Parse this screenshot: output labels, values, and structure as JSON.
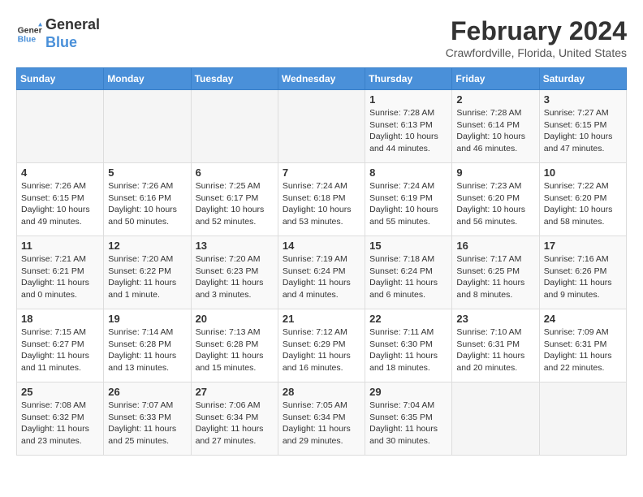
{
  "header": {
    "logo_line1": "General",
    "logo_line2": "Blue",
    "title": "February 2024",
    "subtitle": "Crawfordville, Florida, United States"
  },
  "weekdays": [
    "Sunday",
    "Monday",
    "Tuesday",
    "Wednesday",
    "Thursday",
    "Friday",
    "Saturday"
  ],
  "weeks": [
    [
      {
        "day": "",
        "info": ""
      },
      {
        "day": "",
        "info": ""
      },
      {
        "day": "",
        "info": ""
      },
      {
        "day": "",
        "info": ""
      },
      {
        "day": "1",
        "info": "Sunrise: 7:28 AM\nSunset: 6:13 PM\nDaylight: 10 hours\nand 44 minutes."
      },
      {
        "day": "2",
        "info": "Sunrise: 7:28 AM\nSunset: 6:14 PM\nDaylight: 10 hours\nand 46 minutes."
      },
      {
        "day": "3",
        "info": "Sunrise: 7:27 AM\nSunset: 6:15 PM\nDaylight: 10 hours\nand 47 minutes."
      }
    ],
    [
      {
        "day": "4",
        "info": "Sunrise: 7:26 AM\nSunset: 6:15 PM\nDaylight: 10 hours\nand 49 minutes."
      },
      {
        "day": "5",
        "info": "Sunrise: 7:26 AM\nSunset: 6:16 PM\nDaylight: 10 hours\nand 50 minutes."
      },
      {
        "day": "6",
        "info": "Sunrise: 7:25 AM\nSunset: 6:17 PM\nDaylight: 10 hours\nand 52 minutes."
      },
      {
        "day": "7",
        "info": "Sunrise: 7:24 AM\nSunset: 6:18 PM\nDaylight: 10 hours\nand 53 minutes."
      },
      {
        "day": "8",
        "info": "Sunrise: 7:24 AM\nSunset: 6:19 PM\nDaylight: 10 hours\nand 55 minutes."
      },
      {
        "day": "9",
        "info": "Sunrise: 7:23 AM\nSunset: 6:20 PM\nDaylight: 10 hours\nand 56 minutes."
      },
      {
        "day": "10",
        "info": "Sunrise: 7:22 AM\nSunset: 6:20 PM\nDaylight: 10 hours\nand 58 minutes."
      }
    ],
    [
      {
        "day": "11",
        "info": "Sunrise: 7:21 AM\nSunset: 6:21 PM\nDaylight: 11 hours\nand 0 minutes."
      },
      {
        "day": "12",
        "info": "Sunrise: 7:20 AM\nSunset: 6:22 PM\nDaylight: 11 hours\nand 1 minute."
      },
      {
        "day": "13",
        "info": "Sunrise: 7:20 AM\nSunset: 6:23 PM\nDaylight: 11 hours\nand 3 minutes."
      },
      {
        "day": "14",
        "info": "Sunrise: 7:19 AM\nSunset: 6:24 PM\nDaylight: 11 hours\nand 4 minutes."
      },
      {
        "day": "15",
        "info": "Sunrise: 7:18 AM\nSunset: 6:24 PM\nDaylight: 11 hours\nand 6 minutes."
      },
      {
        "day": "16",
        "info": "Sunrise: 7:17 AM\nSunset: 6:25 PM\nDaylight: 11 hours\nand 8 minutes."
      },
      {
        "day": "17",
        "info": "Sunrise: 7:16 AM\nSunset: 6:26 PM\nDaylight: 11 hours\nand 9 minutes."
      }
    ],
    [
      {
        "day": "18",
        "info": "Sunrise: 7:15 AM\nSunset: 6:27 PM\nDaylight: 11 hours\nand 11 minutes."
      },
      {
        "day": "19",
        "info": "Sunrise: 7:14 AM\nSunset: 6:28 PM\nDaylight: 11 hours\nand 13 minutes."
      },
      {
        "day": "20",
        "info": "Sunrise: 7:13 AM\nSunset: 6:28 PM\nDaylight: 11 hours\nand 15 minutes."
      },
      {
        "day": "21",
        "info": "Sunrise: 7:12 AM\nSunset: 6:29 PM\nDaylight: 11 hours\nand 16 minutes."
      },
      {
        "day": "22",
        "info": "Sunrise: 7:11 AM\nSunset: 6:30 PM\nDaylight: 11 hours\nand 18 minutes."
      },
      {
        "day": "23",
        "info": "Sunrise: 7:10 AM\nSunset: 6:31 PM\nDaylight: 11 hours\nand 20 minutes."
      },
      {
        "day": "24",
        "info": "Sunrise: 7:09 AM\nSunset: 6:31 PM\nDaylight: 11 hours\nand 22 minutes."
      }
    ],
    [
      {
        "day": "25",
        "info": "Sunrise: 7:08 AM\nSunset: 6:32 PM\nDaylight: 11 hours\nand 23 minutes."
      },
      {
        "day": "26",
        "info": "Sunrise: 7:07 AM\nSunset: 6:33 PM\nDaylight: 11 hours\nand 25 minutes."
      },
      {
        "day": "27",
        "info": "Sunrise: 7:06 AM\nSunset: 6:34 PM\nDaylight: 11 hours\nand 27 minutes."
      },
      {
        "day": "28",
        "info": "Sunrise: 7:05 AM\nSunset: 6:34 PM\nDaylight: 11 hours\nand 29 minutes."
      },
      {
        "day": "29",
        "info": "Sunrise: 7:04 AM\nSunset: 6:35 PM\nDaylight: 11 hours\nand 30 minutes."
      },
      {
        "day": "",
        "info": ""
      },
      {
        "day": "",
        "info": ""
      }
    ]
  ]
}
